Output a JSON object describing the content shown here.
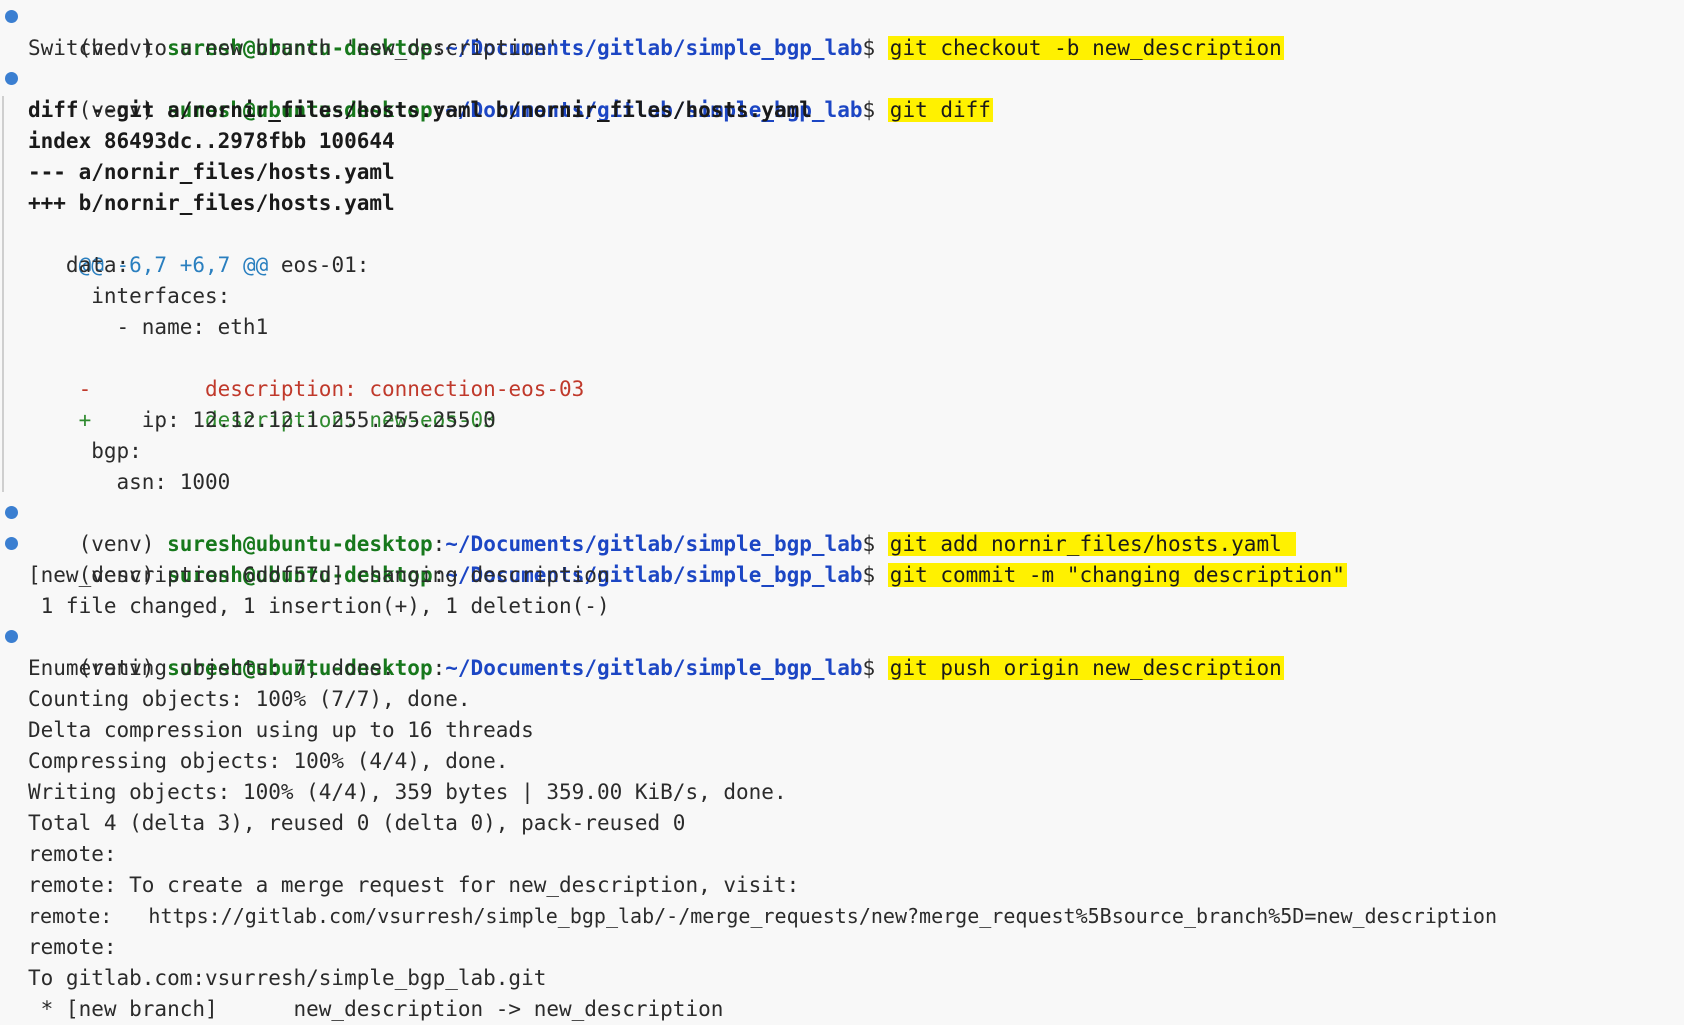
{
  "prompt": {
    "venv": "(venv) ",
    "user": "suresh@ubuntu-desktop",
    "colon": ":",
    "path": "~/Documents/gitlab/simple_bgp_lab",
    "dollar": "$ "
  },
  "commands": {
    "checkout": "git checkout -b new_description",
    "diff": "git diff",
    "add": "git add nornir_files/hosts.yaml ",
    "commit": "git commit -m \"changing description\"",
    "push": "git push origin new_description"
  },
  "checkout_output": "Switched to a new branch 'new_description'",
  "diff_output": {
    "header1": "diff --git a/nornir_files/hosts.yaml b/nornir_files/hosts.yaml",
    "header2": "index 86493dc..2978fbb 100644",
    "header3": "--- a/nornir_files/hosts.yaml",
    "header4": "+++ b/nornir_files/hosts.yaml",
    "hunk": "@@ -6,7 +6,7 @@",
    "hunk_context": " eos-01:",
    "ctx1": "   data:",
    "ctx2": "     interfaces:",
    "ctx3": "       - name: eth1",
    "del_marker": "-",
    "del_text": "         description: connection-eos-03",
    "add_marker": "+",
    "add_text": "         description: new-eos-03",
    "ctx4": "         ip: 12.12.12.1 255.255.255.0",
    "ctx5": "     bgp:",
    "ctx6": "       asn: 1000"
  },
  "commit_output": {
    "line1": "[new_description 6ddf57d] changing description",
    "line2": " 1 file changed, 1 insertion(+), 1 deletion(-)"
  },
  "push_output": [
    "Enumerating objects: 7, done.",
    "Counting objects: 100% (7/7), done.",
    "Delta compression using up to 16 threads",
    "Compressing objects: 100% (4/4), done.",
    "Writing objects: 100% (4/4), 359 bytes | 359.00 KiB/s, done.",
    "Total 4 (delta 3), reused 0 (delta 0), pack-reused 0",
    "remote:",
    "remote: To create a merge request for new_description, visit:",
    "remote:   https://gitlab.com/vsurresh/simple_bgp_lab/-/merge_requests/new?merge_request%5Bsource_branch%5D=new_description",
    "remote:",
    "To gitlab.com:vsurresh/simple_bgp_lab.git",
    " * [new branch]      new_description -> new_description"
  ]
}
